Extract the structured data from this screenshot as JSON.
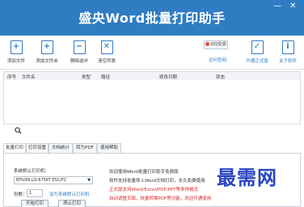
{
  "window": {
    "title": "盛央Word批量打印助手",
    "minimize": "—",
    "close": "✕"
  },
  "toolbar": {
    "buttons": [
      {
        "label": "添加文件",
        "glyph": "+"
      },
      {
        "label": "添加文件夹",
        "glyph": "+"
      },
      {
        "label": "删除选中",
        "glyph": "−"
      },
      {
        "label": "清空列表",
        "glyph": "✕"
      }
    ],
    "qq_label": "QQ交谈",
    "visit_label": "访问官网",
    "right_buttons": [
      {
        "label": "开通正式版",
        "glyph": "✓"
      },
      {
        "label": "关于软件",
        "glyph": "i"
      }
    ]
  },
  "file_table": {
    "columns": [
      "序号",
      "文件名",
      "类型",
      "路径",
      "修改日期",
      "状态"
    ]
  },
  "tabs": [
    "批量打印",
    "打印设置",
    "文档统计",
    "转为PDF",
    "使用帮助"
  ],
  "print_panel": {
    "printer_label": "系统默认打印机：",
    "printer_value": "EPSON LQ-675KT ESC/P2",
    "copies_label": "份数：",
    "copies_value": "1",
    "set_default_link": "设为系统默认打印机",
    "start_button": "开始打印",
    "stop_button": "停止打印"
  },
  "info_lines": [
    {
      "text": "欢迎使用Word批量打印助手免费版",
      "color": "#333333"
    },
    {
      "text": "软件支持批量导入Word文档打印，永久免费使用",
      "color": "#333333"
    },
    {
      "text": "正式版支持Word/Excel/PDF/PPT等多种格式",
      "color": "#d62a2a"
    },
    {
      "text": "自动调整页面，批量转换PDF等功能，欢迎开通使用",
      "color": "#d62a2a"
    }
  ],
  "watermark": "最需网",
  "colors": {
    "accent": "#2f7cc3",
    "warning_text": "#d62a2a",
    "watermark": "#2b45c2"
  }
}
